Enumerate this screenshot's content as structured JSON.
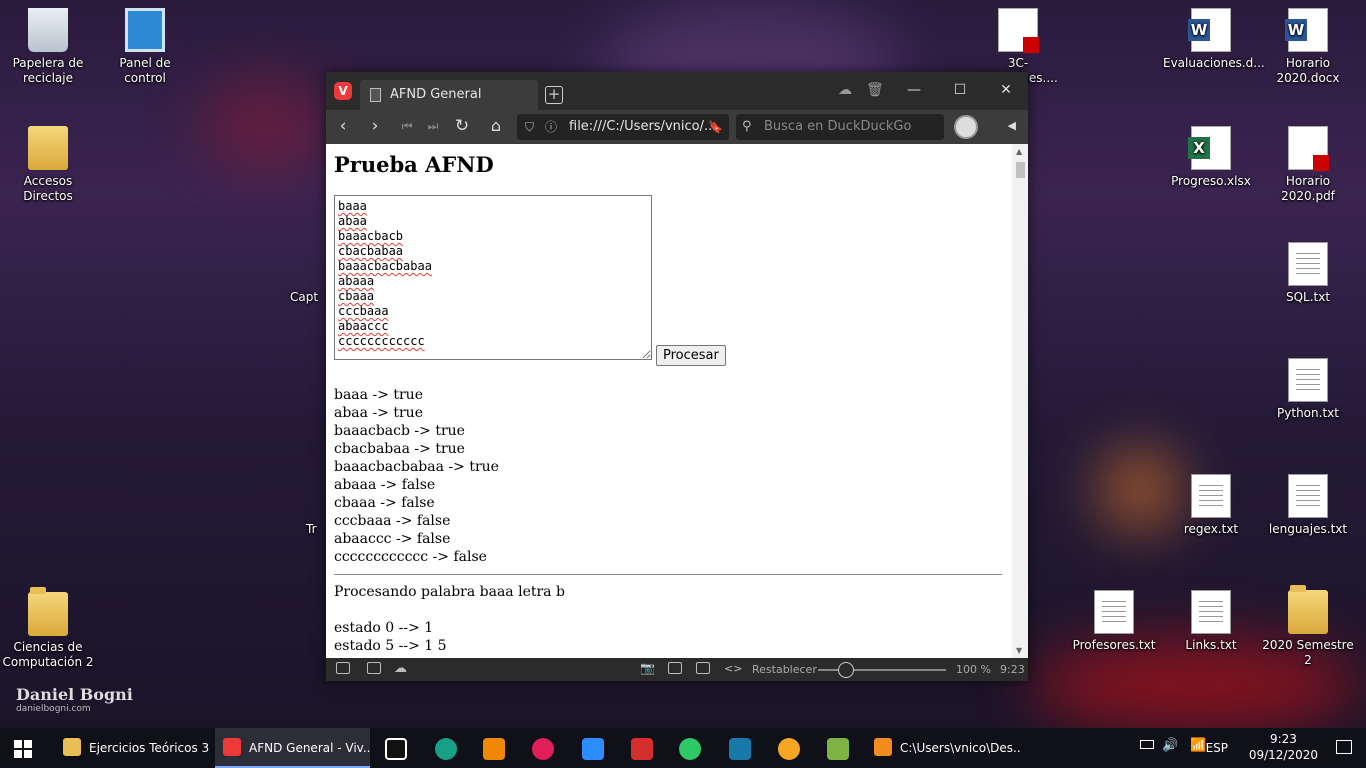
{
  "desktop": {
    "left_icons": [
      {
        "label": "Papelera de reciclaje",
        "icon": "recycle-bin-icon"
      },
      {
        "label": "Panel de control",
        "icon": "control-panel-icon"
      },
      {
        "label": "Accesos Directos",
        "icon": "shortcuts-folder-icon"
      },
      {
        "label": "Ciencias de Computación 2",
        "icon": "folder-icon"
      }
    ],
    "right_icons": [
      {
        "label": "3C-Relaciones....",
        "icon": "pdf-file-icon"
      },
      {
        "label": "Evaluaciones.d...",
        "icon": "word-file-icon"
      },
      {
        "label": "Horario 2020.docx",
        "icon": "word-file-icon"
      },
      {
        "label": "Progreso.xlsx",
        "icon": "excel-file-icon"
      },
      {
        "label": "Horario 2020.pdf",
        "icon": "pdf-file-icon"
      },
      {
        "label": "SQL.txt",
        "icon": "text-file-icon"
      },
      {
        "label": "Python.txt",
        "icon": "text-file-icon"
      },
      {
        "label": "regex.txt",
        "icon": "text-file-icon"
      },
      {
        "label": "lenguajes.txt",
        "icon": "text-file-icon"
      },
      {
        "label": "Profesores.txt",
        "icon": "text-file-icon"
      },
      {
        "label": "Links.txt",
        "icon": "text-file-icon"
      },
      {
        "label": "2020 Semestre 2",
        "icon": "folder-icon"
      }
    ],
    "partial_labels": [
      "Capt",
      "Tr"
    ],
    "watermark": {
      "name": "Daniel Bogni",
      "site": "danielbogni.com"
    }
  },
  "browser": {
    "tab_title": "AFND General",
    "url": "file:///C:/Users/vnico/...",
    "search_placeholder": "Busca en DuckDuckGo",
    "status": {
      "reset_label": "Restablecer",
      "zoom": "100 %",
      "time": "9:23"
    }
  },
  "page": {
    "title": "Prueba AFND",
    "textarea_value": "baaa\nabaa\nbaaacbacb\ncbacbabaa\nbaaacbacbabaa\nabaaa\ncbaaa\ncccbaaa\nabaaccc\ncccccccccccc",
    "button_label": "Procesar",
    "results": [
      "baaa -> true",
      "abaa -> true",
      "baaacbacb -> true",
      "cbacbabaa -> true",
      "baaacbacbabaa -> true",
      "abaaa -> false",
      "cbaaa -> false",
      "cccbaaa -> false",
      "abaaccc -> false",
      "cccccccccccc -> false"
    ],
    "processing_header": "Procesando palabra baaa letra b",
    "states": [
      "estado 0 --> 1",
      "estado 5 --> 1 5"
    ]
  },
  "taskbar": {
    "tasks": [
      {
        "label": "Ejercicios Teóricos 3",
        "icon": "file-explorer-icon",
        "color": "#e8bf55"
      },
      {
        "label": "AFND General - Viv...",
        "icon": "vivaldi-icon",
        "color": "#ef3939"
      },
      {
        "label": "C:\\Users\\vnico\\Des...",
        "icon": "sublime-text-icon",
        "color": "#f28c1e"
      }
    ],
    "clock_time": "9:23",
    "clock_date": "09/12/2020",
    "language": "ESP"
  }
}
